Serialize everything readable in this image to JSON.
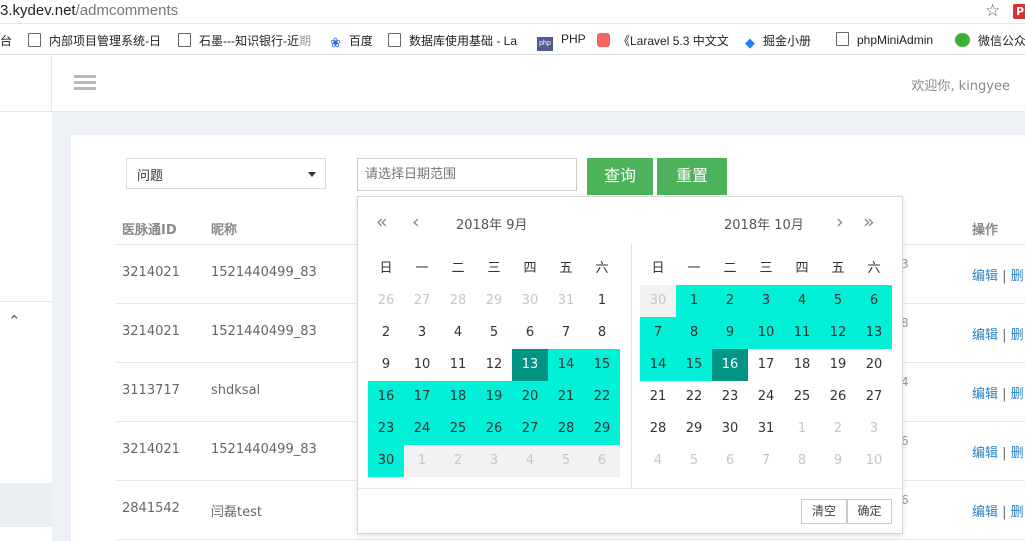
{
  "browser": {
    "url_host": "3.kydev.net",
    "url_path": "/admcomments",
    "bookmarks": [
      {
        "label": "台",
        "icon": "none",
        "fade": ""
      },
      {
        "label": "内部项目管理系统-日",
        "icon": "doc",
        "fade": ""
      },
      {
        "label": "石墨---知识银行-近",
        "icon": "doc",
        "fade": "期"
      },
      {
        "label": "百度",
        "icon": "paw",
        "fade": ""
      },
      {
        "label": "数据库使用基础 - La",
        "icon": "doc",
        "fade": ""
      },
      {
        "label": "PHP",
        "icon": "php",
        "fade": ""
      },
      {
        "label": "《Laravel 5.3 中文文",
        "icon": "lar",
        "fade": ""
      },
      {
        "label": "掘金小册",
        "icon": "jue",
        "fade": ""
      },
      {
        "label": "phpMiniAdmin",
        "icon": "doc",
        "fade": ""
      },
      {
        "label": "微信公众",
        "icon": "wx",
        "fade": ""
      }
    ]
  },
  "header": {
    "welcome": "欢迎你, kingyee"
  },
  "filters": {
    "select_value": "问题",
    "date_placeholder": "请选择日期范围",
    "query_label": "查询",
    "reset_label": "重置"
  },
  "table": {
    "headers": {
      "id": "医脉通ID",
      "nickname": "昵称",
      "ops": "操作"
    },
    "rows": [
      {
        "id": "3214021",
        "nickname": "1521440499_83",
        "peek": "3",
        "edit": "编辑",
        "del": "删"
      },
      {
        "id": "3214021",
        "nickname": "1521440499_83",
        "peek": "8",
        "edit": "编辑",
        "del": "删"
      },
      {
        "id": "3113717",
        "nickname": "shdksal",
        "peek": "4",
        "edit": "编辑",
        "del": "删"
      },
      {
        "id": "3214021",
        "nickname": "1521440499_83",
        "peek": "6",
        "edit": "编辑",
        "del": "删"
      },
      {
        "id": "2841542",
        "nickname": "闫磊test",
        "peek": "6",
        "edit": "编辑",
        "del": "删"
      }
    ]
  },
  "datepicker": {
    "left_title": "2018年  9月",
    "right_title": "2018年  10月",
    "weekdays": [
      "日",
      "一",
      "二",
      "三",
      "四",
      "五",
      "六"
    ],
    "clear_label": "清空",
    "confirm_label": "确定",
    "colors": {
      "range": "#00f0d8",
      "edge": "#009485"
    },
    "left_days": [
      [
        "26",
        "o"
      ],
      [
        "27",
        "o"
      ],
      [
        "28",
        "o"
      ],
      [
        "29",
        "o"
      ],
      [
        "30",
        "o"
      ],
      [
        "31",
        "o"
      ],
      [
        "1",
        ""
      ],
      [
        "2",
        ""
      ],
      [
        "3",
        ""
      ],
      [
        "4",
        ""
      ],
      [
        "5",
        ""
      ],
      [
        "6",
        ""
      ],
      [
        "7",
        ""
      ],
      [
        "8",
        ""
      ],
      [
        "9",
        ""
      ],
      [
        "10",
        ""
      ],
      [
        "11",
        ""
      ],
      [
        "12",
        ""
      ],
      [
        "13",
        "e"
      ],
      [
        "14",
        "r"
      ],
      [
        "15",
        "r"
      ],
      [
        "16",
        "r"
      ],
      [
        "17",
        "r"
      ],
      [
        "18",
        "r"
      ],
      [
        "19",
        "r"
      ],
      [
        "20",
        "r"
      ],
      [
        "21",
        "r"
      ],
      [
        "22",
        "r"
      ],
      [
        "23",
        "r"
      ],
      [
        "24",
        "r"
      ],
      [
        "25",
        "r"
      ],
      [
        "26",
        "r"
      ],
      [
        "27",
        "r"
      ],
      [
        "28",
        "r"
      ],
      [
        "29",
        "r"
      ],
      [
        "30",
        "r"
      ],
      [
        "1",
        "g"
      ],
      [
        "2",
        "g"
      ],
      [
        "3",
        "g"
      ],
      [
        "4",
        "g"
      ],
      [
        "5",
        "g"
      ],
      [
        "6",
        "g"
      ]
    ],
    "right_days": [
      [
        "30",
        "g"
      ],
      [
        "1",
        "r"
      ],
      [
        "2",
        "r"
      ],
      [
        "3",
        "r"
      ],
      [
        "4",
        "r"
      ],
      [
        "5",
        "r"
      ],
      [
        "6",
        "r"
      ],
      [
        "7",
        "r"
      ],
      [
        "8",
        "r"
      ],
      [
        "9",
        "r"
      ],
      [
        "10",
        "r"
      ],
      [
        "11",
        "r"
      ],
      [
        "12",
        "r"
      ],
      [
        "13",
        "r"
      ],
      [
        "14",
        "r"
      ],
      [
        "15",
        "r"
      ],
      [
        "16",
        "e"
      ],
      [
        "17",
        ""
      ],
      [
        "18",
        ""
      ],
      [
        "19",
        ""
      ],
      [
        "20",
        ""
      ],
      [
        "21",
        ""
      ],
      [
        "22",
        ""
      ],
      [
        "23",
        ""
      ],
      [
        "24",
        ""
      ],
      [
        "25",
        ""
      ],
      [
        "26",
        ""
      ],
      [
        "27",
        ""
      ],
      [
        "28",
        ""
      ],
      [
        "29",
        ""
      ],
      [
        "30",
        ""
      ],
      [
        "31",
        ""
      ],
      [
        "1",
        "o"
      ],
      [
        "2",
        "o"
      ],
      [
        "3",
        "o"
      ],
      [
        "4",
        "o"
      ],
      [
        "5",
        "o"
      ],
      [
        "6",
        "o"
      ],
      [
        "7",
        "o"
      ],
      [
        "8",
        "o"
      ],
      [
        "9",
        "o"
      ],
      [
        "10",
        "o"
      ]
    ]
  }
}
